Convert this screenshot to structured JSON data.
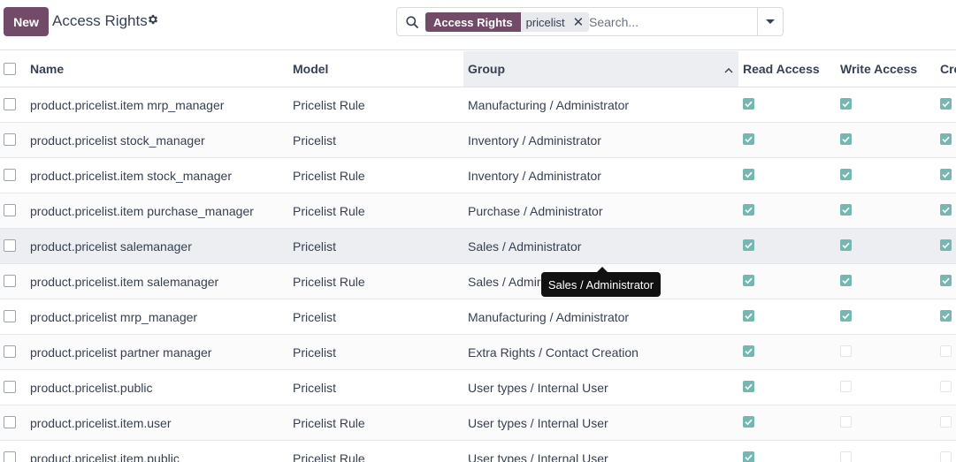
{
  "control_panel": {
    "new_label": "New",
    "title": "Access Rights",
    "settings_icon": "gear-icon",
    "search": {
      "facet_label": "Access Rights",
      "facet_value": "pricelist",
      "placeholder": "Search...",
      "value": ""
    }
  },
  "table": {
    "columns": {
      "name": "Name",
      "model": "Model",
      "group": "Group",
      "read": "Read Access",
      "write": "Write Access",
      "create": "Cre"
    },
    "sorted_column": "group",
    "rows": [
      {
        "name": "product.pricelist.item mrp_manager",
        "model": "Pricelist Rule",
        "group": "Manufacturing / Administrator",
        "read": true,
        "write": true,
        "create": true
      },
      {
        "name": "product.pricelist stock_manager",
        "model": "Pricelist",
        "group": "Inventory / Administrator",
        "read": true,
        "write": true,
        "create": true
      },
      {
        "name": "product.pricelist.item stock_manager",
        "model": "Pricelist Rule",
        "group": "Inventory / Administrator",
        "read": true,
        "write": true,
        "create": true
      },
      {
        "name": "product.pricelist.item purchase_manager",
        "model": "Pricelist Rule",
        "group": "Purchase / Administrator",
        "read": true,
        "write": true,
        "create": true
      },
      {
        "name": "product.pricelist salemanager",
        "model": "Pricelist",
        "group": "Sales / Administrator",
        "read": true,
        "write": true,
        "create": true
      },
      {
        "name": "product.pricelist.item salemanager",
        "model": "Pricelist Rule",
        "group": "Sales / Admir",
        "read": true,
        "write": true,
        "create": true
      },
      {
        "name": "product.pricelist mrp_manager",
        "model": "Pricelist",
        "group": "Manufacturing / Administrator",
        "read": true,
        "write": true,
        "create": true
      },
      {
        "name": "product.pricelist partner manager",
        "model": "Pricelist",
        "group": "Extra Rights / Contact Creation",
        "read": true,
        "write": false,
        "create": false
      },
      {
        "name": "product.pricelist.public",
        "model": "Pricelist",
        "group": "User types / Internal User",
        "read": true,
        "write": false,
        "create": false
      },
      {
        "name": "product.pricelist.item.user",
        "model": "Pricelist Rule",
        "group": "User types / Internal User",
        "read": true,
        "write": false,
        "create": false
      },
      {
        "name": "product.pricelist.item.public",
        "model": "Pricelist Rule",
        "group": "User types / Internal User",
        "read": true,
        "write": false,
        "create": false
      }
    ]
  },
  "tooltip": {
    "text": "Sales / Administrator"
  },
  "colors": {
    "brand": "#714b67",
    "checked": "#76b7b2"
  }
}
